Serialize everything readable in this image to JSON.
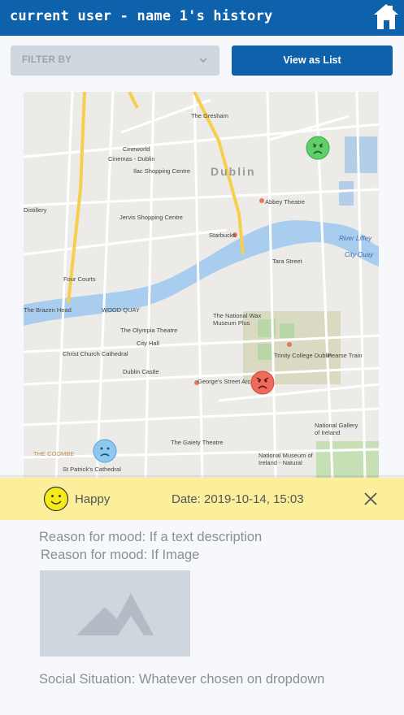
{
  "header": {
    "title": "current user - name 1's history",
    "home_icon": "home-icon"
  },
  "toolbar": {
    "filter_label": "FILTER BY",
    "view_label": "View as List"
  },
  "map": {
    "city_label": "Dublin",
    "labels": {
      "gresham": "The Gresham",
      "cineworld": "Cineworld",
      "cineworld2": "Cinemas - Dublin",
      "ilac": "Ilac Shopping Centre",
      "abbey": "Abbey Theatre",
      "distillery": "Distillery",
      "jervis": "Jervis Shopping Centre",
      "starbucks": "Starbucks",
      "tara": "Tara Street",
      "river": "River Liffey",
      "cityquay": "City Quay",
      "fourcourts": "Four Courts",
      "brazen": "The Brazen Head",
      "woodquay": "WOOD QUAY",
      "olympia": "The Olympia Theatre",
      "cityhall": "City Hall",
      "waxmuseum": "The National Wax Museum Plus",
      "trinity": "Trinity College Dublin",
      "pearse": "Pearse Train",
      "christchurch": "Christ Church Cathedral",
      "castle": "Dublin Castle",
      "georges": "George's Street Arcade",
      "gaiety": "The Gaiety Theatre",
      "museum": "National Museum of Ireland - Natural",
      "gallery": "National Gallery of Ireland",
      "coombe": "THE COOMBE",
      "patricks": "St Patrick's Cathedral"
    }
  },
  "entry": {
    "mood": "Happy",
    "date": "Date: 2019-10-14, 15:03",
    "reason_text": "Reason for mood: If a text description",
    "reason_image": "Reason for mood: If Image",
    "social": "Social Situation: Whatever chosen on dropdown"
  },
  "colors": {
    "brand_blue": "#0e62ac",
    "happy_yellow": "#fbef9c",
    "green_marker": "#5fcf6a",
    "red_marker": "#ef6a5a",
    "blue_marker": "#8cc8ef"
  }
}
